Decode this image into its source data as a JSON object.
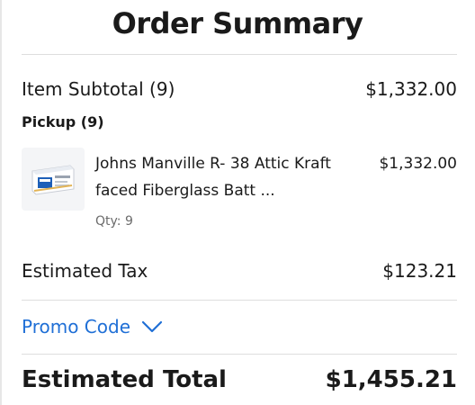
{
  "title": "Order Summary",
  "subtotal": {
    "label": "Item Subtotal (9)",
    "value": "$1,332.00"
  },
  "pickup": {
    "label": "Pickup (9)",
    "item": {
      "name_line1": "Johns Manville R- 38 Attic Kraft",
      "name_line2": "faced Fiberglass Batt ...",
      "price": "$1,332.00",
      "qty": "Qty: 9",
      "thumbnail_icon": "insulation-product-icon"
    }
  },
  "tax": {
    "label": "Estimated Tax",
    "value": "$123.21"
  },
  "promo": {
    "label": "Promo Code",
    "icon": "chevron-down-icon",
    "color": "#1f6fd6"
  },
  "total": {
    "label": "Estimated Total",
    "value": "$1,455.21"
  }
}
